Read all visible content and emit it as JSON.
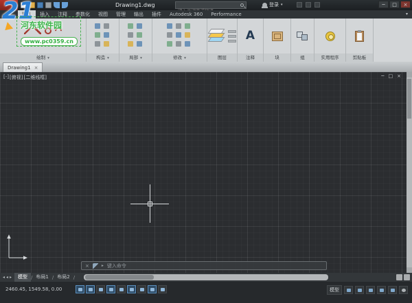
{
  "glyphs": {
    "caret_down": "▾",
    "arrow_left": "◂",
    "arrow_right": "▸",
    "slash": "/",
    "minimize": "─",
    "restore": "□",
    "close": "×"
  },
  "watermark": {
    "logo": "21",
    "name": "河东软件园",
    "url": "www.pc0359.cn"
  },
  "titlebar": {
    "title": "Drawing1.dwg",
    "search_placeholder": "键入关键字或短语",
    "signin": "登录"
  },
  "ribbon_tabs": [
    "默认",
    "插入",
    "注释",
    "参数化",
    "视图",
    "管理",
    "输出",
    "插件",
    "Autodesk 360",
    "Performance"
  ],
  "ribbon_panels": [
    "绘制",
    "构造",
    "局部",
    "修改",
    "图层",
    "注释",
    "块",
    "组",
    "实用程序",
    "剪贴板"
  ],
  "ribbon_icons": {
    "annotation_letter": "A"
  },
  "file_tab": {
    "name": "Drawing1"
  },
  "viewport_controls": {
    "menu": "[-]",
    "view": "[俯视]",
    "style": "[二维线框]"
  },
  "command_line": {
    "prompt": "键入命令"
  },
  "layout_tabs": [
    "模型",
    "布局1",
    "布局2"
  ],
  "status": {
    "coordinates": "2460.45, 1549.58, 0.00",
    "model": "模型"
  }
}
